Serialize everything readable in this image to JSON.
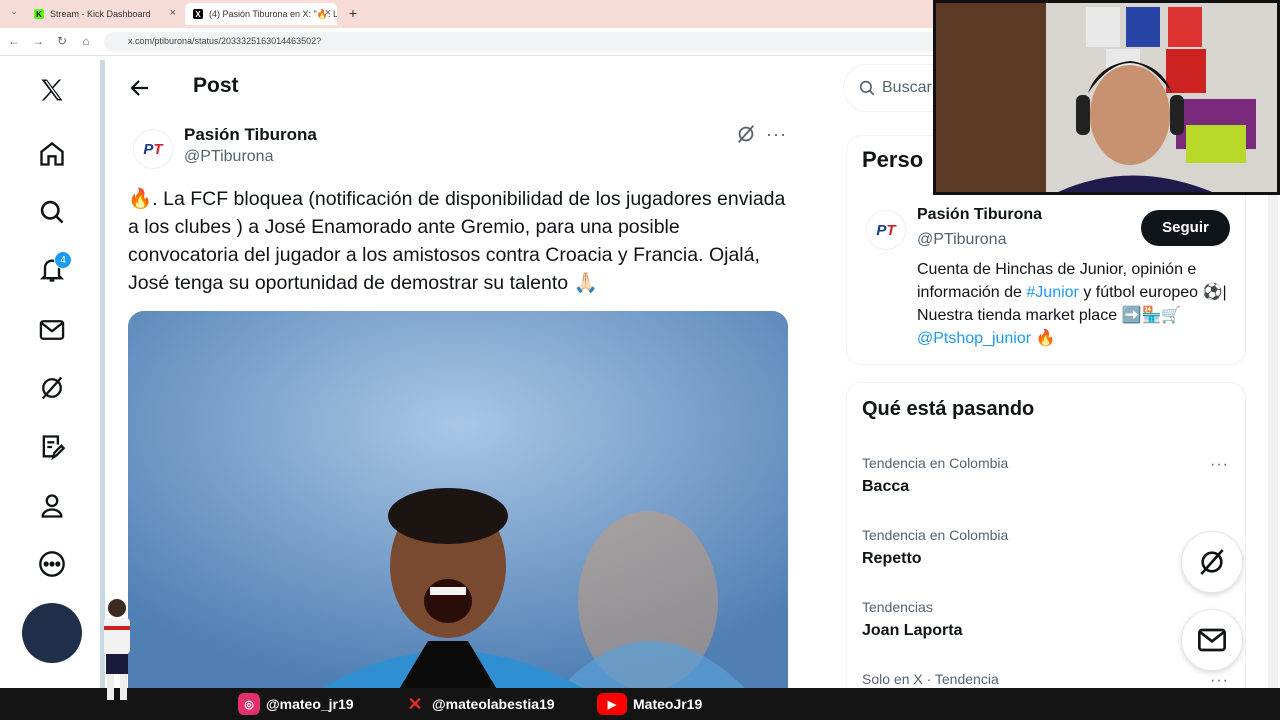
{
  "browser": {
    "tabs": [
      {
        "label": "Stream - Kick Dashboard",
        "favicon": "K",
        "color": "#53fc18"
      },
      {
        "label": "(4) Pasión Tiburona en X: \"🔥. L",
        "favicon": "X",
        "color": "#000000"
      }
    ],
    "new_tab": "+",
    "url": "x.com/ptiburona/status/2033325163014463502?"
  },
  "nav": {
    "notification_count": "4"
  },
  "post": {
    "header_title": "Post",
    "author_name": "Pasión Tiburona",
    "author_handle": "@PTiburona",
    "text": "🔥. La FCF bloquea (notificación de disponibilidad de los jugadores enviada a los clubes ) a José Enamorado ante Gremio, para una posible convocatoria del jugador a los amistosos contra Croacia y Francia. Ojalá,  José tenga su oportunidad de demostrar su talento 🙏🏻"
  },
  "right": {
    "search_placeholder": "Buscar",
    "relevant_title": "Perso",
    "profile": {
      "name": "Pasión Tiburona",
      "handle": "@PTiburona",
      "follow_label": "Seguir",
      "bio_1": "Cuenta de Hinchas de Junior, opinión e información de ",
      "bio_link_1": "#Junior",
      "bio_2": " y fútbol europeo ⚽️| Nuestra tienda market place ➡️🏪🛒",
      "bio_link_2": "@Ptshop_junior",
      "bio_3": " 🔥"
    },
    "trends_title": "Qué está pasando",
    "trends": [
      {
        "context": "Tendencia en Colombia",
        "name": "Bacca"
      },
      {
        "context": "Tendencia en Colombia",
        "name": "Repetto"
      },
      {
        "context": "Tendencias",
        "name": "Joan Laporta"
      },
      {
        "context": "Solo en X · Tendencia",
        "name": ""
      }
    ]
  },
  "overlay": {
    "socials": [
      {
        "platform": "instagram-icon",
        "handle": "@mateo_jr19",
        "color": "#e1306c"
      },
      {
        "platform": "x-icon",
        "handle": "@mateolabestia19",
        "color": "#d9202a"
      },
      {
        "platform": "youtube-icon",
        "handle": "MateoJr19",
        "color": "#ff0000"
      }
    ]
  },
  "colors": {
    "accent": "#1d9bf0",
    "text": "#0f1419",
    "muted": "#536471"
  }
}
